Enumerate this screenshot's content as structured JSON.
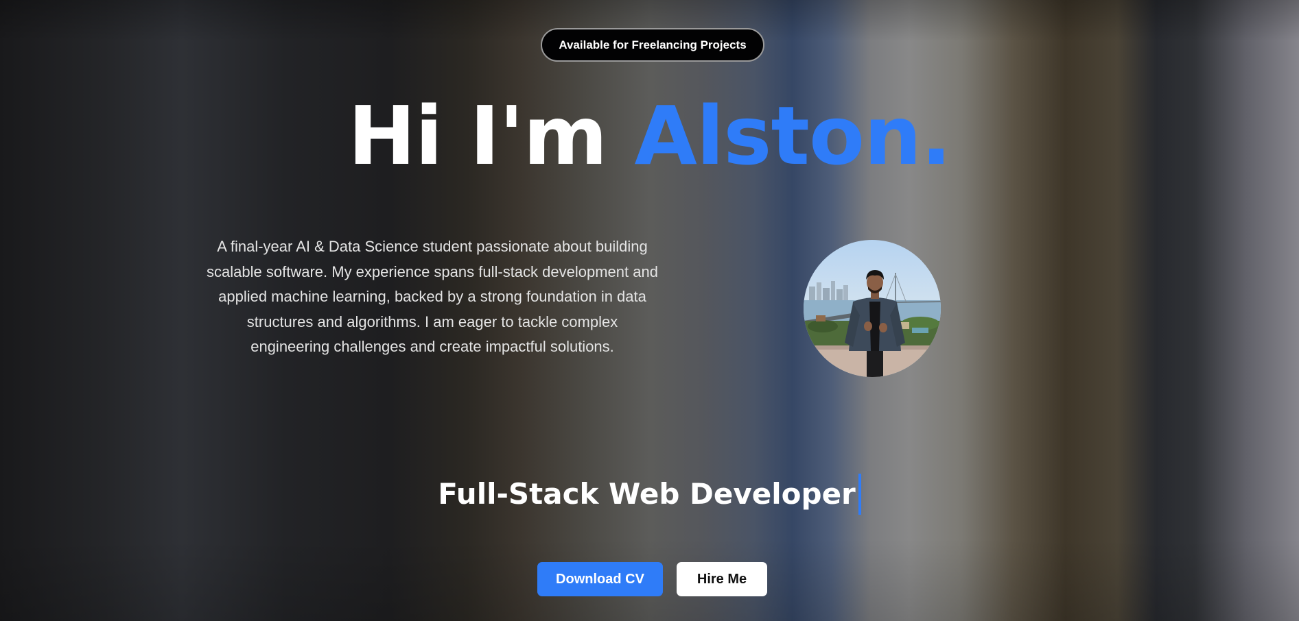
{
  "badge": {
    "label": "Available for Freelancing Projects"
  },
  "hero": {
    "greeting": "Hi I'm",
    "name": "Alston."
  },
  "bio": {
    "text": "A final-year AI & Data Science student passionate about building scalable software. My experience spans full-stack development and applied machine learning, backed by a strong foundation in data structures and algorithms. I am eager to tackle complex engineering challenges and create impactful solutions."
  },
  "profile_photo": {
    "icon": "profile-photo"
  },
  "role": {
    "text": "Full-Stack Web Developer"
  },
  "actions": {
    "download_cv": "Download CV",
    "hire_me": "Hire Me"
  },
  "colors": {
    "accent": "#2f7cf8",
    "badge_bg": "#020203",
    "secondary_button_bg": "#ffffff"
  }
}
